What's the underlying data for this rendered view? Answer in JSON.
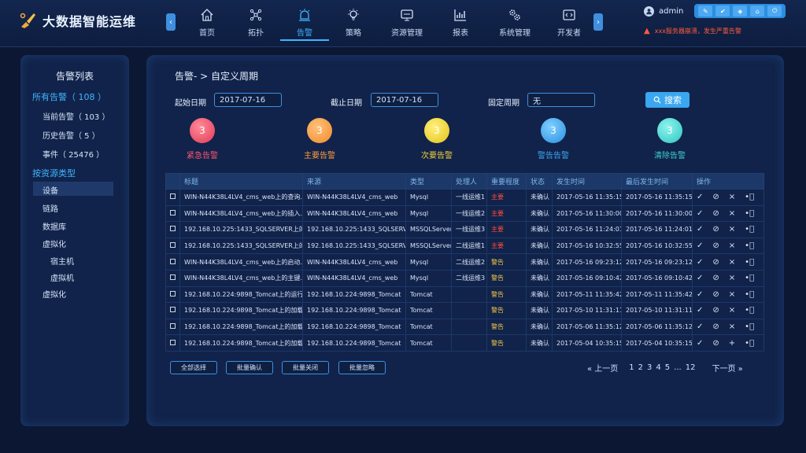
{
  "app": {
    "title": "大数据智能运维"
  },
  "nav": {
    "items": [
      {
        "label": "首页",
        "icon": "home-icon"
      },
      {
        "label": "拓扑",
        "icon": "topology-icon"
      },
      {
        "label": "告警",
        "icon": "alarm-icon",
        "active": true
      },
      {
        "label": "策略",
        "icon": "bulb-icon"
      },
      {
        "label": "资源管理",
        "icon": "monitor-icon"
      },
      {
        "label": "报表",
        "icon": "chart-icon"
      },
      {
        "label": "系统管理",
        "icon": "gears-icon"
      },
      {
        "label": "开发者",
        "icon": "code-icon"
      }
    ]
  },
  "user": {
    "name": "admin"
  },
  "alert": {
    "message": "xxx服务器崩溃，发生严重告警"
  },
  "colors": {
    "accent": "#3fb6ff",
    "background": "#0b1733",
    "panel": "#11234a",
    "danger": "#ff4b3a",
    "warning": "#f0c94a"
  },
  "sidebar": {
    "title": "告警列表",
    "section_all": "所有告警（ 108 ）",
    "items": [
      "当前告警（ 103 ）",
      "历史告警（ 5 ）",
      "事件（ 25476 ）"
    ],
    "section_resource": "按资源类型",
    "resource_items": [
      "设备",
      "链路",
      "数据库",
      "虚拟化",
      "宿主机",
      "虚拟机",
      "虚拟化"
    ]
  },
  "main": {
    "breadcrumb": "告警- > 自定义周期",
    "filters": {
      "start_label": "起始日期",
      "start_value": "2017-07-16",
      "end_label": "截止日期",
      "end_value": "2017-07-16",
      "period_label": "固定周期",
      "period_value": "无",
      "search_label": "搜索"
    },
    "stats": [
      {
        "count": "3",
        "label": "紧急告警"
      },
      {
        "count": "3",
        "label": "主要告警"
      },
      {
        "count": "3",
        "label": "次要告警"
      },
      {
        "count": "3",
        "label": "警告告警"
      },
      {
        "count": "3",
        "label": "清除告警"
      }
    ],
    "table": {
      "headers": [
        "标题",
        "来源",
        "类型",
        "处理人",
        "重要程度",
        "状态",
        "发生时间",
        "最后发生时间",
        "操作"
      ],
      "rows": [
        [
          "WIN-N44K38L4LV4_cms_web上的查询...",
          "WIN-N44K38L4LV4_cms_web",
          "Mysql",
          "一线运维1",
          "主要",
          "未确认",
          "2017-05-16  11:35:15",
          "2017-05-16  11:35:15"
        ],
        [
          "WIN-N44K38L4LV4_cms_web上的插入...",
          "WIN-N44K38L4LV4_cms_web",
          "Mysql",
          "一线运维2",
          "主要",
          "未确认",
          "2017-05-16  11:30:00",
          "2017-05-16  11:30:00"
        ],
        [
          "192.168.10.225:1433_SQLSERVER上的...",
          "192.168.10.225:1433_SQLSERVER",
          "MSSQLServer",
          "一线运维3",
          "主要",
          "未确认",
          "2017-05-16  11:24:01",
          "2017-05-16  11:24:01"
        ],
        [
          "192.168.10.225:1433_SQLSERVER上的...",
          "192.168.10.225:1433_SQLSERVER",
          "MSSQLServer",
          "二线运维1",
          "主要",
          "未确认",
          "2017-05-16  10:32:55",
          "2017-05-16  10:32:55"
        ],
        [
          "WIN-N44K38L4LV4_cms_web上的启动...",
          "WIN-N44K38L4LV4_cms_web",
          "Mysql",
          "二线运维2",
          "警告",
          "未确认",
          "2017-05-16  09:23:12",
          "2017-05-16  09:23:12"
        ],
        [
          "WIN-N44K38L4LV4_cms_web上的主键...",
          "WIN-N44K38L4LV4_cms_web",
          "Mysql",
          "二线运维3",
          "警告",
          "未确认",
          "2017-05-16  09:10:42",
          "2017-05-16  09:10:42"
        ],
        [
          "192.168.10.224:9898_Tomcat上的运行...",
          "192.168.10.224:9898_Tomcat",
          "Tomcat",
          "",
          "警告",
          "未确认",
          "2017-05-11  11:35:42",
          "2017-05-11  11:35:42"
        ],
        [
          "192.168.10.224:9898_Tomcat上的加载...",
          "192.168.10.224:9898_Tomcat",
          "Tomcat",
          "",
          "警告",
          "未确认",
          "2017-05-10  11:31:11",
          "2017-05-10  11:31:11"
        ],
        [
          "192.168.10.224:9898_Tomcat上的加载...",
          "192.168.10.224:9898_Tomcat",
          "Tomcat",
          "",
          "警告",
          "未确认",
          "2017-05-06  11:35:12",
          "2017-05-06  11:35:12"
        ],
        [
          "192.168.10.224:9898_Tomcat上的加载...",
          "192.168.10.224:9898_Tomcat",
          "Tomcat",
          "",
          "警告",
          "未确认",
          "2017-05-04  10:35:15",
          "2017-05-04  10:35:15"
        ]
      ],
      "row_ops": [
        "✓",
        "⊘",
        "×",
        "•⃣"
      ],
      "last_row_ops": [
        "✓",
        "⊘",
        "+",
        "•⃣"
      ]
    },
    "bulk_buttons": [
      "全部选择",
      "批量确认",
      "批量关闭",
      "批量忽略"
    ],
    "pager": {
      "prev": "« 上一页",
      "pages": [
        "1",
        "2",
        "3",
        "4",
        "5",
        "...",
        "12"
      ],
      "next": "下一页 »"
    }
  }
}
